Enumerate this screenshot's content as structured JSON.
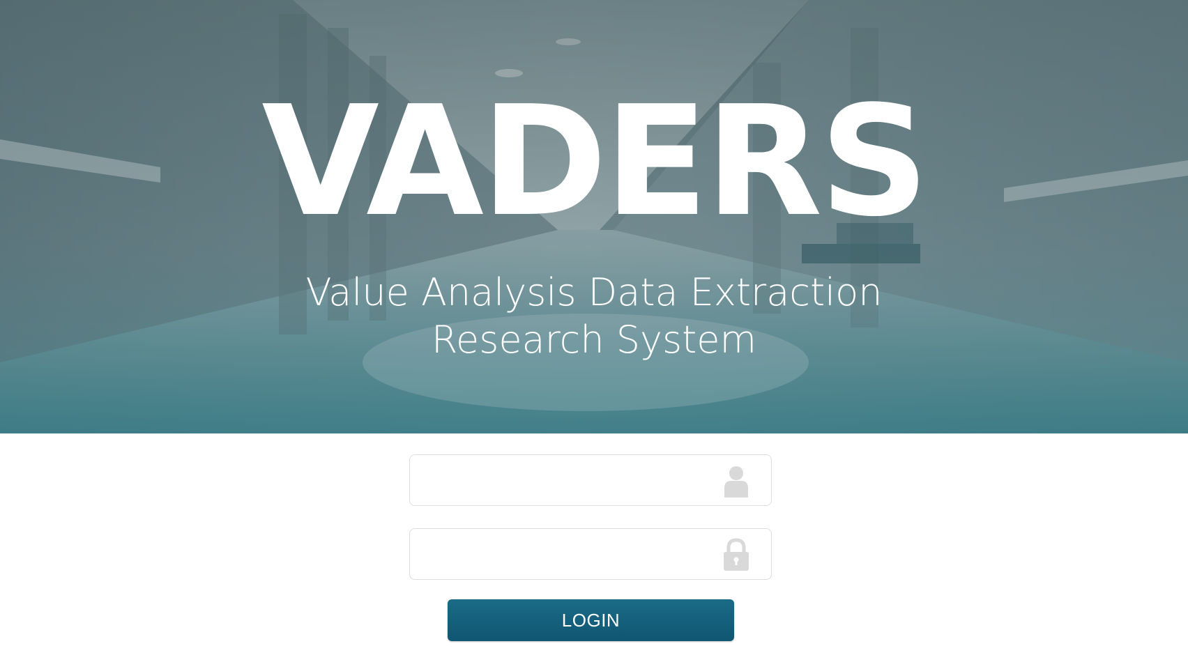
{
  "hero": {
    "title": "VADERS",
    "subtitle_line1": "Value Analysis Data Extraction",
    "subtitle_line2": "Research System"
  },
  "login_form": {
    "username": {
      "value": "",
      "placeholder": "",
      "icon": "user-icon"
    },
    "password": {
      "value": "",
      "placeholder": "",
      "icon": "lock-icon"
    },
    "submit_label": "LOGIN"
  },
  "colors": {
    "button": "#135f7c",
    "field_border": "#dddddd",
    "icon": "#d9d9d9",
    "hero_tint": "#3e6a72"
  }
}
